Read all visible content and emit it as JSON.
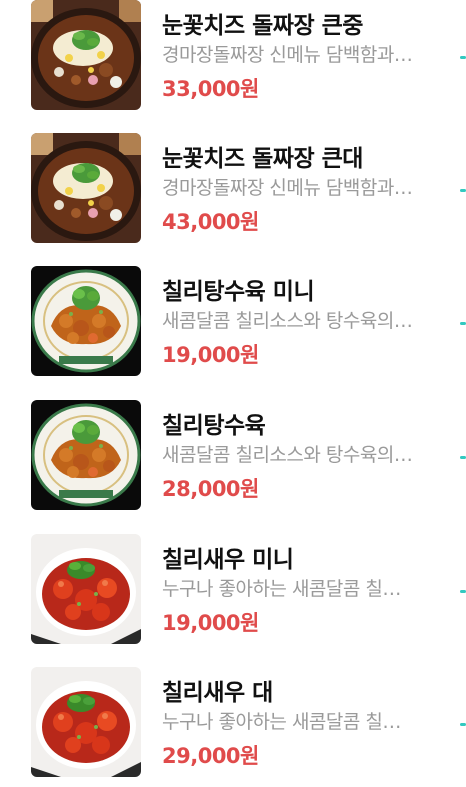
{
  "accent_price_color": "#e04b4b",
  "menu": {
    "items": [
      {
        "name": "눈꽃치즈 돌짜장 큰중",
        "description": "경마장돌짜장 신메뉴 담백함과 고소함",
        "price": "33,000원",
        "image_icon": "cheese-jjajang-dish-image"
      },
      {
        "name": "눈꽃치즈 돌짜장 큰대",
        "description": "경마장돌짜장 신메뉴 담백함과 고소함",
        "price": "43,000원",
        "image_icon": "cheese-jjajang-dish-image"
      },
      {
        "name": "칠리탕수육 미니",
        "description": "새콤달콤 칠리소스와 탕수육의 만남",
        "price": "19,000원",
        "image_icon": "chili-tangsuyuk-dish-image"
      },
      {
        "name": "칠리탕수육",
        "description": "새콤달콤 칠리소스와 탕수육의 만남",
        "price": "28,000원",
        "image_icon": "chili-tangsuyuk-dish-image"
      },
      {
        "name": "칠리새우 미니",
        "description": "누구나 좋아하는 새콤달콤 칠리새우",
        "price": "19,000원",
        "image_icon": "chili-shrimp-dish-image"
      },
      {
        "name": "칠리새우 대",
        "description": "누구나 좋아하는 새콤달콤 칠리새우",
        "price": "29,000원",
        "image_icon": "chili-shrimp-dish-image"
      }
    ]
  }
}
